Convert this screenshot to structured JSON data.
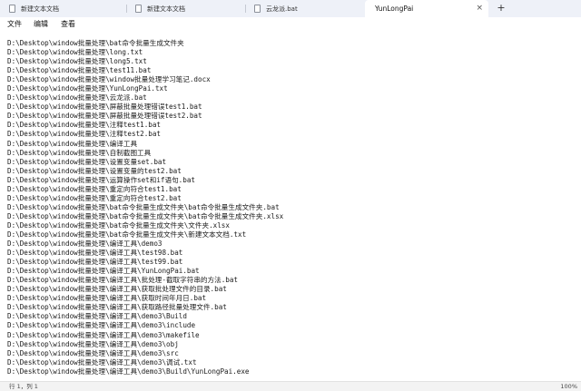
{
  "tabs": [
    {
      "label": "新建文本文档",
      "active": false
    },
    {
      "label": "新建文本文档",
      "active": false
    },
    {
      "label": "云龙派.bat",
      "active": false
    },
    {
      "label": "YunLongPai",
      "active": true
    }
  ],
  "tab_close_glyph": "×",
  "new_tab_glyph": "+",
  "menu": {
    "file": "文件",
    "edit": "编辑",
    "view": "查看"
  },
  "content_lines": [
    "D:\\Desktop\\window批量处理\\bat命令批量生成文件夹",
    "D:\\Desktop\\window批量处理\\long.txt",
    "D:\\Desktop\\window批量处理\\long5.txt",
    "D:\\Desktop\\window批量处理\\test11.bat",
    "D:\\Desktop\\window批量处理\\window批量处理学习笔记.docx",
    "D:\\Desktop\\window批量处理\\YunLongPai.txt",
    "D:\\Desktop\\window批量处理\\云龙派.bat",
    "D:\\Desktop\\window批量处理\\屏蔽批量处理错误test1.bat",
    "D:\\Desktop\\window批量处理\\屏蔽批量处理错误test2.bat",
    "D:\\Desktop\\window批量处理\\注释test1.bat",
    "D:\\Desktop\\window批量处理\\注释test2.bat",
    "D:\\Desktop\\window批量处理\\编译工具",
    "D:\\Desktop\\window批量处理\\自制截图工具",
    "D:\\Desktop\\window批量处理\\设置变量set.bat",
    "D:\\Desktop\\window批量处理\\设置变量的test2.bat",
    "D:\\Desktop\\window批量处理\\运算操作set和if语句.bat",
    "D:\\Desktop\\window批量处理\\重定向符合test1.bat",
    "D:\\Desktop\\window批量处理\\重定向符合test2.bat",
    "D:\\Desktop\\window批量处理\\bat命令批量生成文件夹\\bat命令批量生成文件夹.bat",
    "D:\\Desktop\\window批量处理\\bat命令批量生成文件夹\\bat命令批量生成文件夹.xlsx",
    "D:\\Desktop\\window批量处理\\bat命令批量生成文件夹\\文件夹.xlsx",
    "D:\\Desktop\\window批量处理\\bat命令批量生成文件夹\\新建文本文档.txt",
    "D:\\Desktop\\window批量处理\\编译工具\\demo3",
    "D:\\Desktop\\window批量处理\\编译工具\\test98.bat",
    "D:\\Desktop\\window批量处理\\编译工具\\test99.bat",
    "D:\\Desktop\\window批量处理\\编译工具\\YunLongPai.bat",
    "D:\\Desktop\\window批量处理\\编译工具\\批处理-截取字符串的方法.bat",
    "D:\\Desktop\\window批量处理\\编译工具\\获取批处理文件的目录.bat",
    "D:\\Desktop\\window批量处理\\编译工具\\获取时间年月日.bat",
    "D:\\Desktop\\window批量处理\\编译工具\\获取路径批量处理文件.bat",
    "D:\\Desktop\\window批量处理\\编译工具\\demo3\\Build",
    "D:\\Desktop\\window批量处理\\编译工具\\demo3\\include",
    "D:\\Desktop\\window批量处理\\编译工具\\demo3\\makefile",
    "D:\\Desktop\\window批量处理\\编译工具\\demo3\\obj",
    "D:\\Desktop\\window批量处理\\编译工具\\demo3\\src",
    "D:\\Desktop\\window批量处理\\编译工具\\demo3\\调试.txt",
    "D:\\Desktop\\window批量处理\\编译工具\\demo3\\Build\\YunLongPai.exe"
  ],
  "status": {
    "position": "行 1，列 1",
    "zoom": "100%"
  },
  "colors": {
    "tabbar_bg": "#eef1f8",
    "active_tab_bg": "#ffffff",
    "text": "#1a1a1a",
    "statusbar_bg": "#f3f3f3"
  }
}
